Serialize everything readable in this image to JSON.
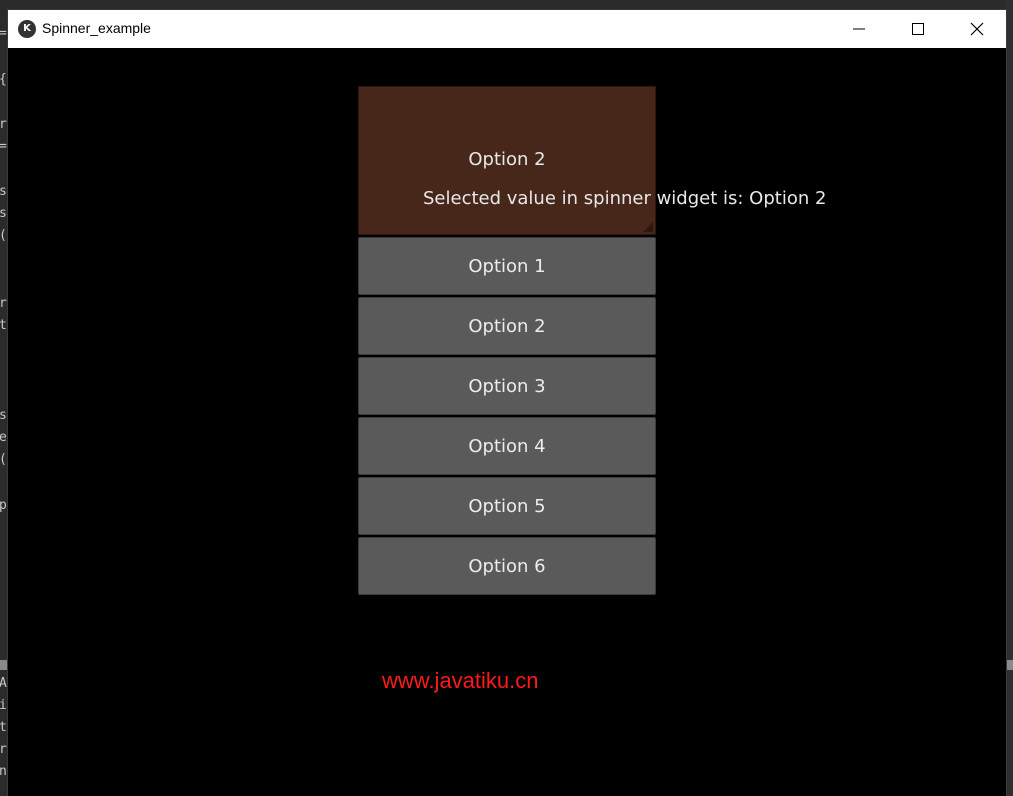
{
  "window": {
    "title": "Spinner_example",
    "minimize_icon": "minimize-icon",
    "maximize_icon": "maximize-icon",
    "close_icon": "close-icon"
  },
  "background_editor": {
    "line_chars": [
      "=",
      "{",
      "r",
      "=",
      "s",
      "s",
      "(",
      "r",
      "t",
      "s",
      "e",
      "(",
      "p",
      "A",
      "i",
      "t",
      "r",
      "n"
    ]
  },
  "spinner": {
    "text": "Option 2",
    "color": "#46271a",
    "options": [
      "Option 1",
      "Option 2",
      "Option 3",
      "Option 4",
      "Option 5",
      "Option 6"
    ]
  },
  "selected_label": "Selected value in spinner widget is: Option 2",
  "watermark": "www.javatiku.cn"
}
